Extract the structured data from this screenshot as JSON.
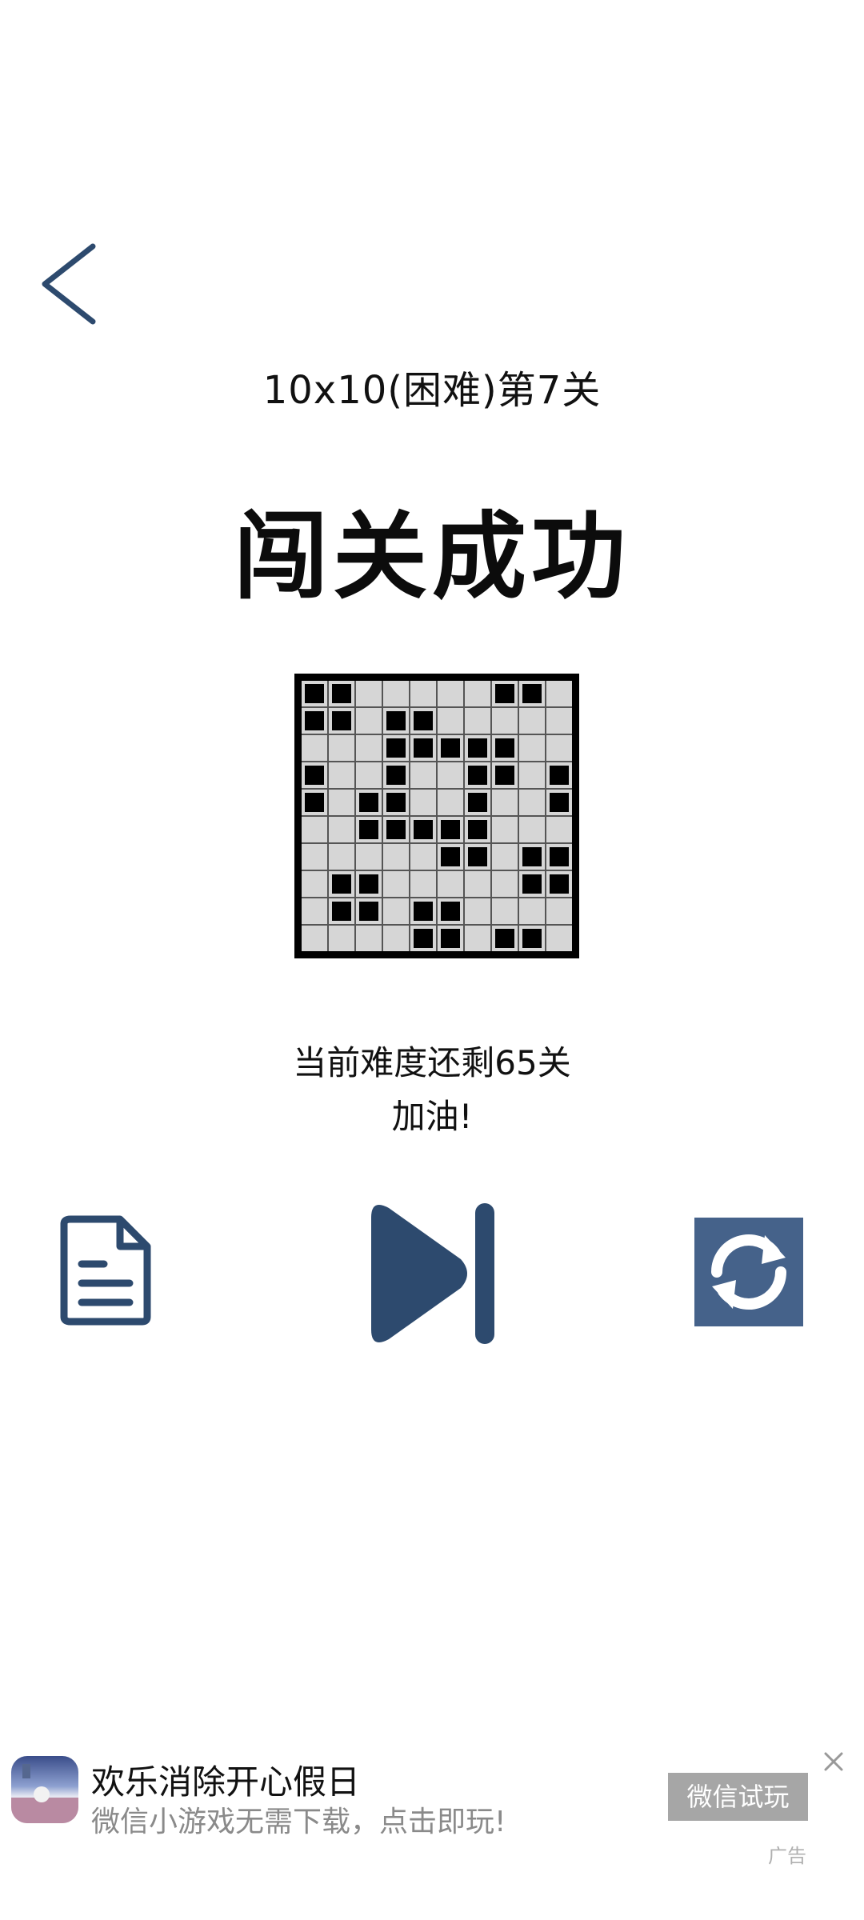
{
  "header": {
    "level_title": "10x10(困难)第7关",
    "result_title": "闯关成功"
  },
  "puzzle": {
    "rows": 10,
    "cols": 10,
    "grid": [
      [
        1,
        1,
        0,
        0,
        0,
        0,
        0,
        1,
        1,
        0
      ],
      [
        1,
        1,
        0,
        1,
        1,
        0,
        0,
        0,
        0,
        0
      ],
      [
        0,
        0,
        0,
        1,
        1,
        1,
        1,
        1,
        0,
        0
      ],
      [
        1,
        0,
        0,
        1,
        0,
        0,
        1,
        1,
        0,
        1
      ],
      [
        1,
        0,
        1,
        1,
        0,
        0,
        1,
        0,
        0,
        1
      ],
      [
        0,
        0,
        1,
        1,
        1,
        1,
        1,
        0,
        0,
        0
      ],
      [
        0,
        0,
        0,
        0,
        0,
        1,
        1,
        0,
        1,
        1
      ],
      [
        0,
        1,
        1,
        0,
        0,
        0,
        0,
        0,
        1,
        1
      ],
      [
        0,
        1,
        1,
        0,
        1,
        1,
        0,
        0,
        0,
        0
      ],
      [
        0,
        0,
        0,
        0,
        1,
        1,
        0,
        1,
        1,
        0
      ]
    ]
  },
  "status": {
    "remaining": "当前难度还剩65关",
    "cheer": "加油!"
  },
  "icons": {
    "back": "chevron-left-icon",
    "doc": "document-icon",
    "next": "skip-next-icon",
    "refresh": "refresh-icon"
  },
  "colors": {
    "accent": "#2d4a6e",
    "refresh_bg": "#45628a"
  },
  "ad": {
    "title": "欢乐消除开心假日",
    "subtitle": "微信小游戏无需下载，点击即玩!",
    "button": "微信试玩",
    "label": "广告"
  }
}
